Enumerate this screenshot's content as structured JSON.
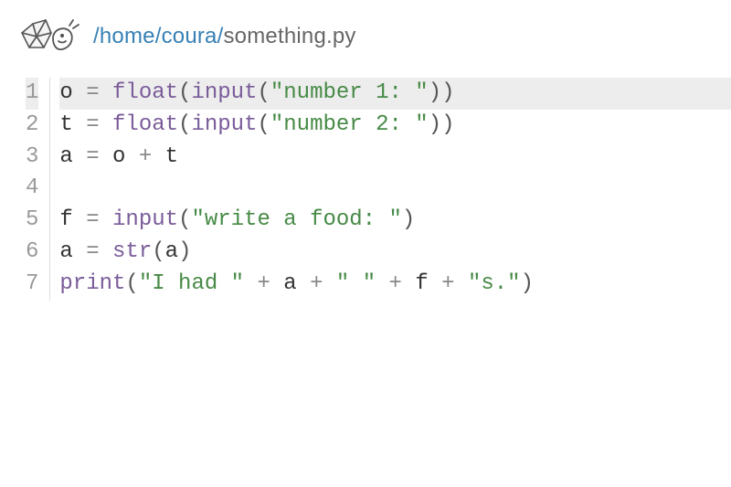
{
  "header": {
    "path_dir": "/home/coura/",
    "path_file": "something.py"
  },
  "editor": {
    "current_line": 1,
    "lines": [
      {
        "num": "1",
        "tokens": [
          {
            "cls": "tok-var",
            "t": "o "
          },
          {
            "cls": "tok-op",
            "t": "= "
          },
          {
            "cls": "tok-builtin",
            "t": "float"
          },
          {
            "cls": "tok-paren",
            "t": "("
          },
          {
            "cls": "tok-builtin",
            "t": "input"
          },
          {
            "cls": "tok-paren",
            "t": "("
          },
          {
            "cls": "tok-str",
            "t": "\"number 1: \""
          },
          {
            "cls": "tok-paren",
            "t": "))"
          }
        ]
      },
      {
        "num": "2",
        "tokens": [
          {
            "cls": "tok-var",
            "t": "t "
          },
          {
            "cls": "tok-op",
            "t": "= "
          },
          {
            "cls": "tok-builtin",
            "t": "float"
          },
          {
            "cls": "tok-paren",
            "t": "("
          },
          {
            "cls": "tok-builtin",
            "t": "input"
          },
          {
            "cls": "tok-paren",
            "t": "("
          },
          {
            "cls": "tok-str",
            "t": "\"number 2: \""
          },
          {
            "cls": "tok-paren",
            "t": "))"
          }
        ]
      },
      {
        "num": "3",
        "tokens": [
          {
            "cls": "tok-var",
            "t": "a "
          },
          {
            "cls": "tok-op",
            "t": "= "
          },
          {
            "cls": "tok-var",
            "t": "o "
          },
          {
            "cls": "tok-op",
            "t": "+ "
          },
          {
            "cls": "tok-var",
            "t": "t"
          }
        ]
      },
      {
        "num": "4",
        "tokens": []
      },
      {
        "num": "5",
        "tokens": [
          {
            "cls": "tok-var",
            "t": "f "
          },
          {
            "cls": "tok-op",
            "t": "= "
          },
          {
            "cls": "tok-builtin",
            "t": "input"
          },
          {
            "cls": "tok-paren",
            "t": "("
          },
          {
            "cls": "tok-str",
            "t": "\"write a food: \""
          },
          {
            "cls": "tok-paren",
            "t": ")"
          }
        ]
      },
      {
        "num": "6",
        "tokens": [
          {
            "cls": "tok-var",
            "t": "a "
          },
          {
            "cls": "tok-op",
            "t": "= "
          },
          {
            "cls": "tok-builtin",
            "t": "str"
          },
          {
            "cls": "tok-paren",
            "t": "("
          },
          {
            "cls": "tok-var",
            "t": "a"
          },
          {
            "cls": "tok-paren",
            "t": ")"
          }
        ]
      },
      {
        "num": "7",
        "tokens": [
          {
            "cls": "tok-builtin",
            "t": "print"
          },
          {
            "cls": "tok-paren",
            "t": "("
          },
          {
            "cls": "tok-str",
            "t": "\"I had \""
          },
          {
            "cls": "tok-op",
            "t": " + "
          },
          {
            "cls": "tok-var",
            "t": "a"
          },
          {
            "cls": "tok-op",
            "t": " + "
          },
          {
            "cls": "tok-str",
            "t": "\" \""
          },
          {
            "cls": "tok-op",
            "t": " + "
          },
          {
            "cls": "tok-var",
            "t": "f"
          },
          {
            "cls": "tok-op",
            "t": " + "
          },
          {
            "cls": "tok-str",
            "t": "\"s.\""
          },
          {
            "cls": "tok-paren",
            "t": ")"
          }
        ]
      }
    ]
  }
}
